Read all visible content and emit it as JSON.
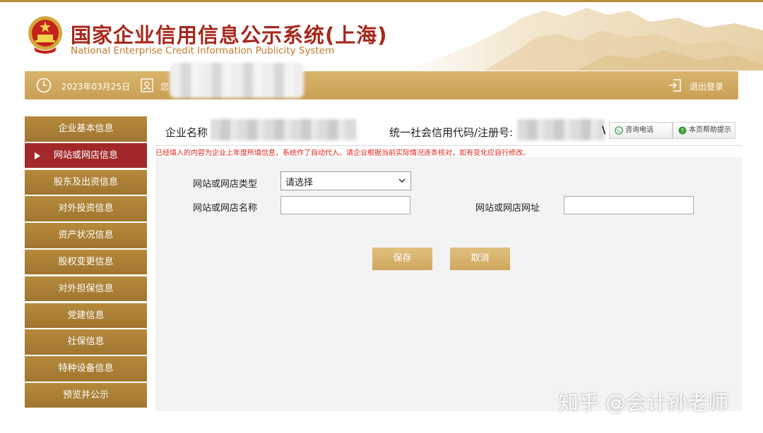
{
  "header": {
    "title_cn": "国家企业信用信息公示系统(上海)",
    "title_en": "National Enterprise Credit Information Publicity System",
    "emblem_icon": "national-emblem-icon"
  },
  "topbar": {
    "date": "2023年03月25日",
    "greeting": "您",
    "logout_label": "退出登录"
  },
  "sidebar": {
    "items": [
      {
        "label": "企业基本信息"
      },
      {
        "label": "网站或网店信息"
      },
      {
        "label": "股东及出资信息"
      },
      {
        "label": "对外投资信息"
      },
      {
        "label": "资产状况信息"
      },
      {
        "label": "股权变更信息"
      },
      {
        "label": "对外担保信息"
      },
      {
        "label": "党建信息"
      },
      {
        "label": "社保信息"
      },
      {
        "label": "特种设备信息"
      },
      {
        "label": "预览并公示"
      }
    ],
    "active_index": 1
  },
  "company": {
    "name_label": "企业名称",
    "code_label": "统一社会信用代码/注册号:",
    "code_tail": "\\"
  },
  "toolbar": {
    "consult_label": "咨询电话",
    "help_label": "本页帮助提示"
  },
  "notice": "已经填入的内容为企业上年度所填信息，系统作了自动代入。请企业根据当前实际情况逐条核对，如有变化应自行修改。",
  "form": {
    "type_label": "网站或网店类型",
    "type_value": "请选择",
    "name_label": "网站或网店名称",
    "name_value": "",
    "url_label": "网站或网店网址",
    "url_value": "",
    "save_label": "保存",
    "cancel_label": "取消"
  },
  "watermark": "知乎 @会计孙老师",
  "colors": {
    "gold": "#c9a055",
    "active_red": "#a2282a",
    "title_red": "#a6281c",
    "notice_red": "#e0261c"
  }
}
